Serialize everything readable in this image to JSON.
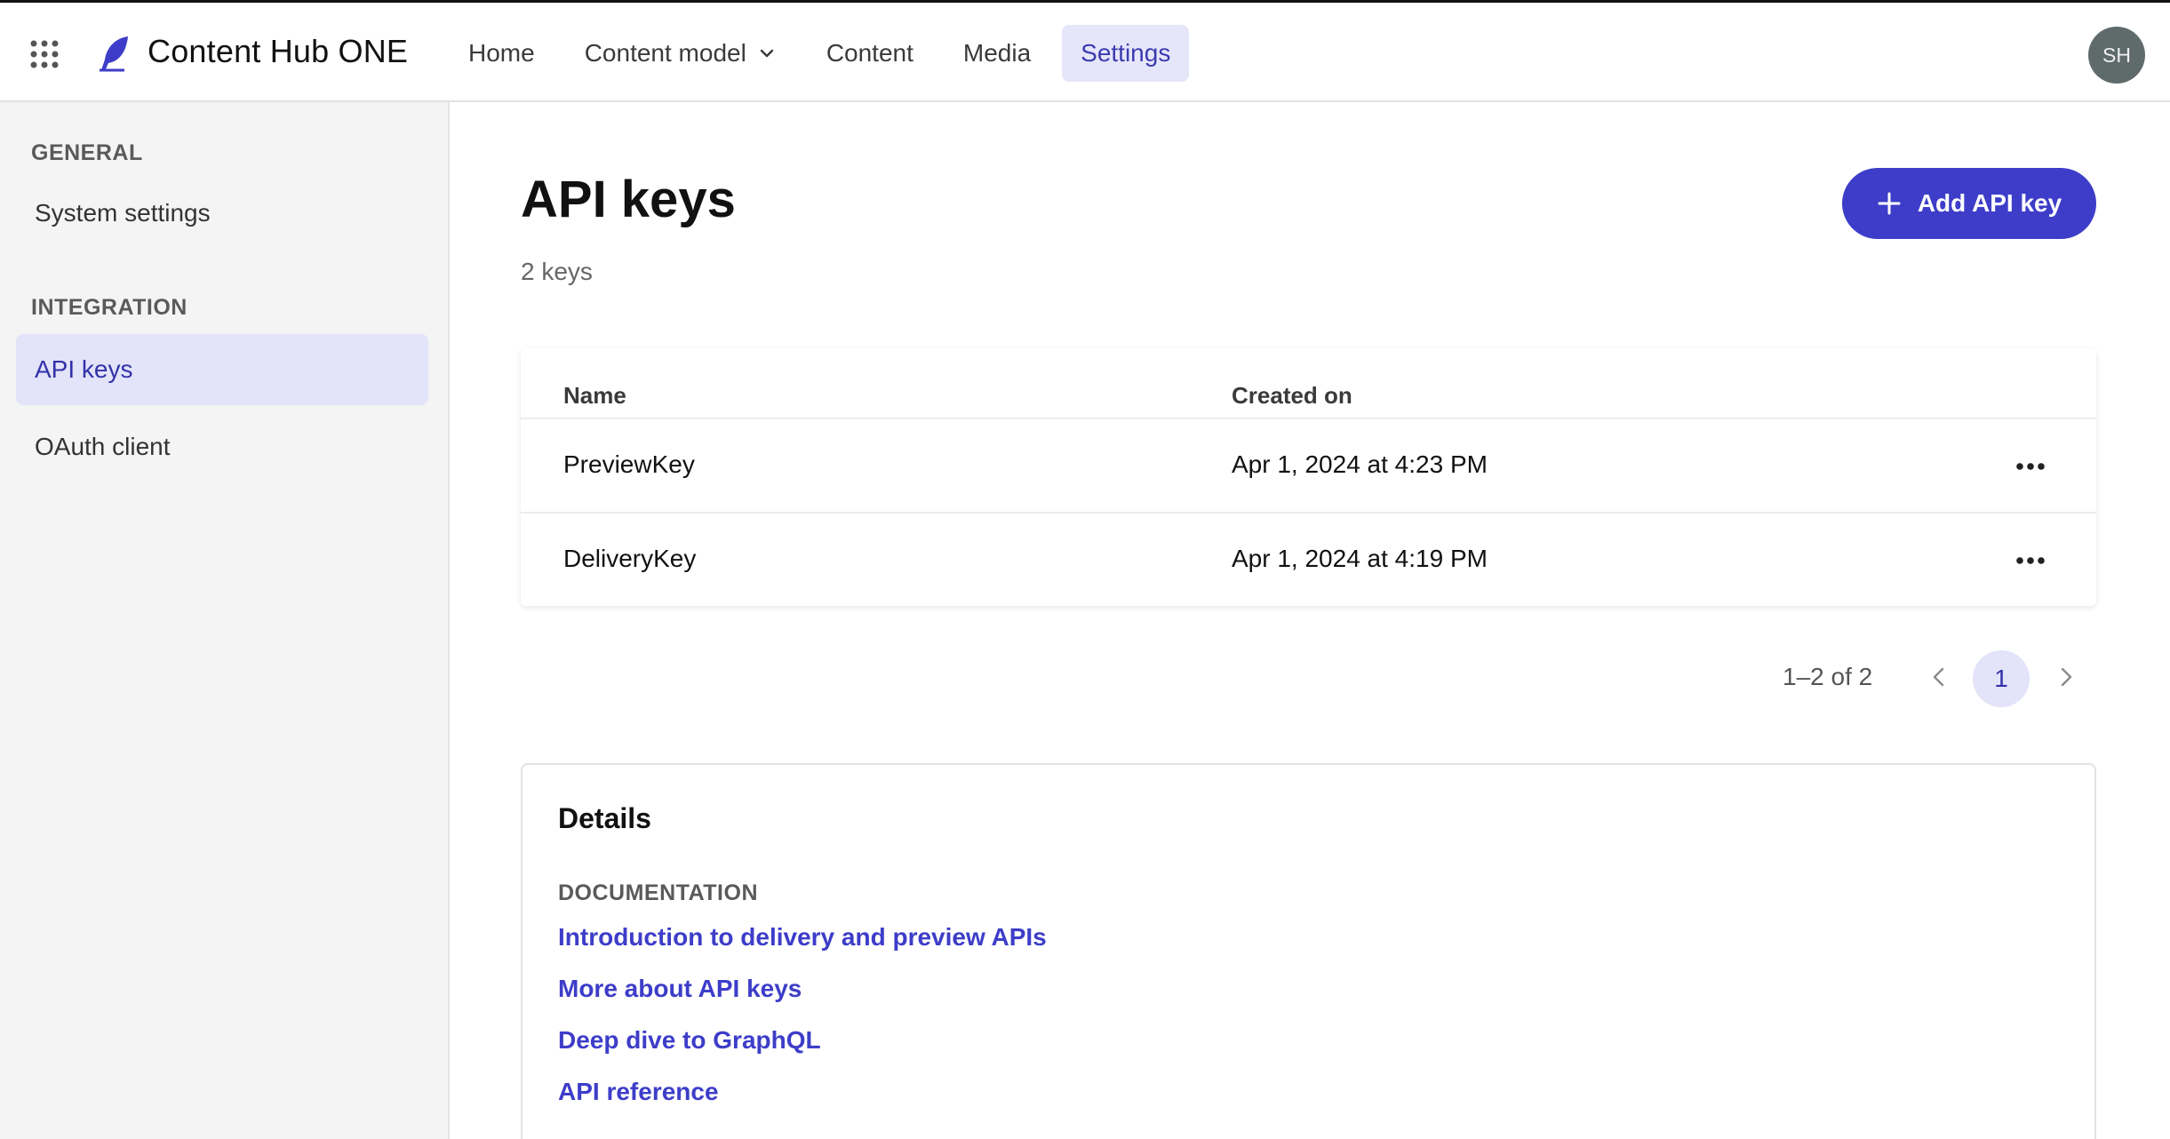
{
  "header": {
    "brand": "Content Hub ONE",
    "nav": [
      {
        "label": "Home"
      },
      {
        "label": "Content model"
      },
      {
        "label": "Content"
      },
      {
        "label": "Media"
      },
      {
        "label": "Settings",
        "active": true
      }
    ],
    "avatar_initials": "SH"
  },
  "sidebar": {
    "sections": [
      {
        "title": "GENERAL",
        "items": [
          {
            "label": "System settings"
          }
        ]
      },
      {
        "title": "INTEGRATION",
        "items": [
          {
            "label": "API keys",
            "active": true
          },
          {
            "label": "OAuth client"
          }
        ]
      }
    ]
  },
  "main": {
    "title": "API keys",
    "count": "2 keys",
    "add_button": "Add API key",
    "table": {
      "columns": [
        "Name",
        "Created on"
      ],
      "rows": [
        {
          "name": "PreviewKey",
          "created": "Apr 1, 2024 at 4:23 PM"
        },
        {
          "name": "DeliveryKey",
          "created": "Apr 1, 2024 at 4:19 PM"
        }
      ]
    },
    "pagination": {
      "range": "1–2 of 2",
      "current_page": "1"
    },
    "details": {
      "title": "Details",
      "doc_heading": "DOCUMENTATION",
      "links": [
        "Introduction to delivery and preview APIs",
        "More about API keys",
        "Deep dive to GraphQL",
        "API reference"
      ]
    }
  },
  "colors": {
    "accent": "#3d3dc9",
    "active_bg": "#e3e3fa",
    "sidebar_bg": "#f4f4f4",
    "avatar_bg": "#5f6b6b"
  },
  "icons": [
    "app-grid-icon",
    "quill-logo-icon",
    "chevron-down-icon",
    "plus-icon",
    "more-horizontal-icon",
    "chevron-left-icon",
    "chevron-right-icon"
  ]
}
